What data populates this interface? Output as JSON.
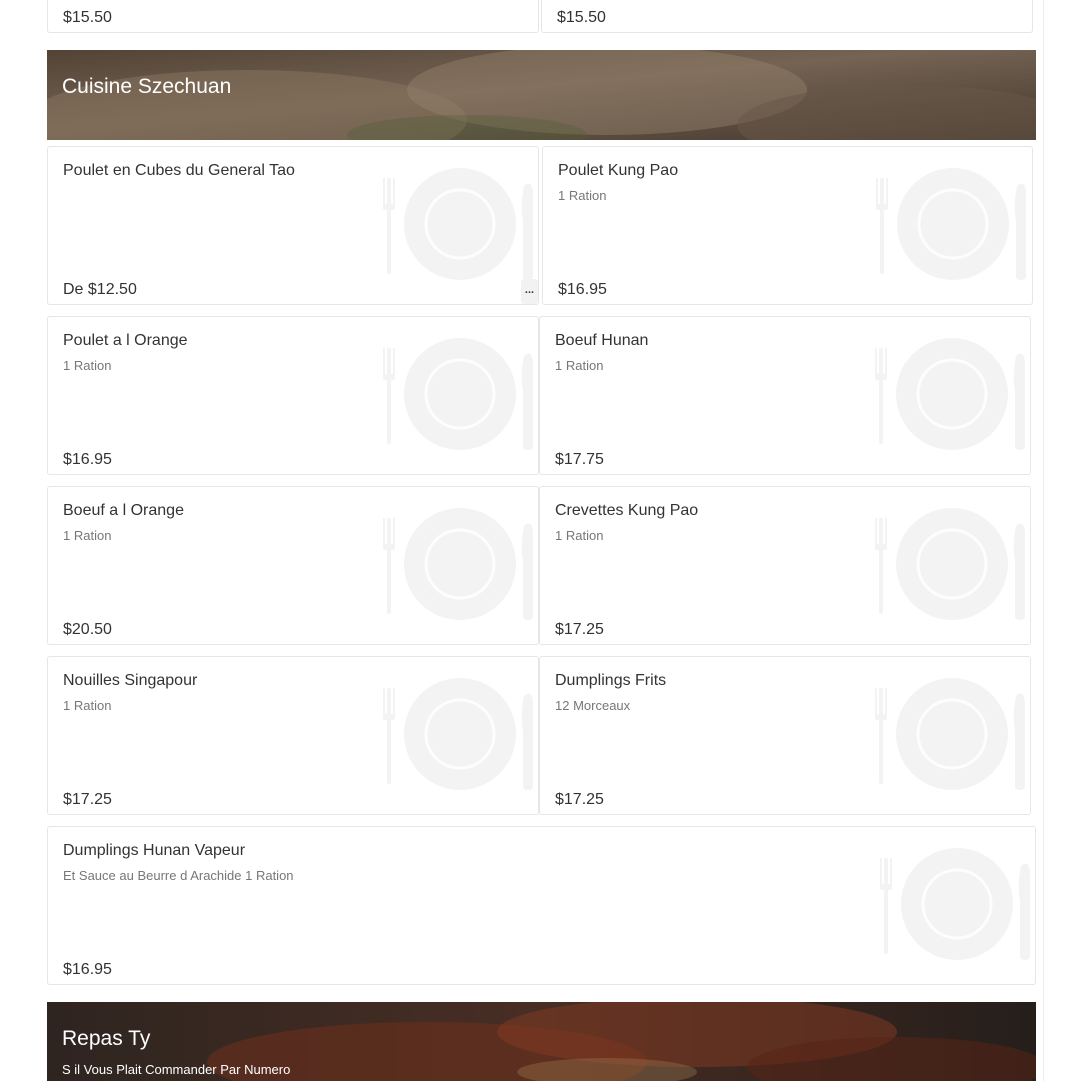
{
  "top_row": [
    {
      "price": "$15.50"
    },
    {
      "price": "$15.50"
    }
  ],
  "sections": [
    {
      "title": "Cuisine Szechuan",
      "items": [
        {
          "name": "Poulet en Cubes du General Tao",
          "description": "",
          "price": "De $12.50",
          "more_label": "..."
        },
        {
          "name": "Poulet Kung Pao",
          "description": "1 Ration",
          "price": "$16.95"
        },
        {
          "name": "Poulet a l Orange",
          "description": "1 Ration",
          "price": "$16.95"
        },
        {
          "name": "Boeuf Hunan",
          "description": "1 Ration",
          "price": "$17.75"
        },
        {
          "name": "Boeuf a l Orange",
          "description": "1 Ration",
          "price": "$20.50"
        },
        {
          "name": "Crevettes Kung Pao",
          "description": "1 Ration",
          "price": "$17.25"
        },
        {
          "name": "Nouilles Singapour",
          "description": "1 Ration",
          "price": "$17.25"
        },
        {
          "name": "Dumplings Frits",
          "description": "12 Morceaux",
          "price": "$17.25"
        },
        {
          "name": "Dumplings Hunan Vapeur",
          "description": "Et Sauce au Beurre d Arachide 1 Ration",
          "price": "$16.95"
        }
      ]
    },
    {
      "title": "Repas Ty",
      "subtitle": "S il Vous Plait Commander Par Numero",
      "items": []
    }
  ],
  "icons": {
    "item_placeholder": "plate-fork-knife-icon",
    "more": "ellipsis-icon"
  },
  "colors": {
    "card_border": "#e6e6e6",
    "text": "#333333",
    "muted_text": "#777777",
    "placeholder": "#f3f3f3",
    "banner_text": "#ffffff"
  }
}
